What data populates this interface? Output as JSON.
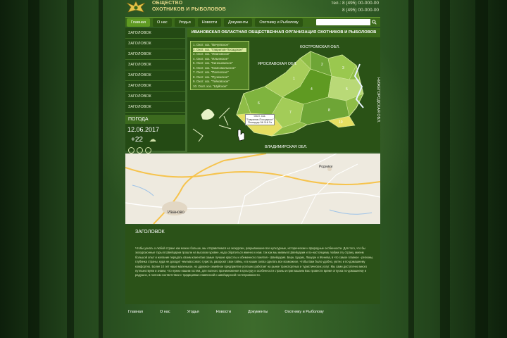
{
  "header": {
    "logo_line1": "ОБЩЕСТВО",
    "logo_line2": "ОХОТНИКОВ И РЫБОЛОВОВ",
    "phone1": "тел.: 8 (495) 00-000-00",
    "phone2": "8 (495) 00-000-00"
  },
  "nav": {
    "items": [
      "Главная",
      "О нас",
      "Угодья",
      "Новости",
      "Документы",
      "Охотнику и Рыболову"
    ],
    "search_button": "Q"
  },
  "sidebar": {
    "items": [
      "ЗАГОЛОВОК",
      "ЗАГОЛОВОК",
      "ЗАГОЛОВОК",
      "ЗАГОЛОВОК",
      "ЗАГОЛОВОК",
      "ЗАГОЛОВОК",
      "ЗАГОЛОВОК",
      "ЗАГОЛОВОК"
    ],
    "weather_title": "ПОГОДА",
    "date": "12.06.2017",
    "temp": "+22"
  },
  "map": {
    "title": "ИВАНОВСКАЯ ОБЛАСТНАЯ ОБЩЕСТВЕННАЯ ОРГАНИЗАЦИЯ ОХОТНИКОВ И РЫБОЛОВОВ",
    "list": [
      "1. Охот. хоз. \"Вичугвское\"",
      "2. Охот. хоз. \"Гаврилов-Посадское\"",
      "3. Охот. хоз. \"Ивановское\"",
      "4. Охот. хоз. \"Ильинское\"",
      "5. Охот. хоз. \"Кинешемское\"",
      "6. Охот. хоз. \"Комсомольское\"",
      "7. Охот. хоз. \"Палехское\"",
      "8. Охот. хоз. \"Пучежское\"",
      "9. Охот. хоз. \"Тейковское\"",
      "10. Охот. хоз. \"Шуйское\""
    ],
    "region_kostroma": "КОСТРОМСКАЯ ОБЛ.",
    "region_yaroslavl": "ЯРОСЛАВСКАЯ ОБЛ.",
    "region_vladimir": "ВЛАДИМИРСКАЯ ОБЛ.",
    "region_nizhny": "НИЖЕГОРОДСКАЯ ОБЛ.",
    "tooltip_line1": "Охот. хоз.",
    "tooltip_line2": "\"Гаврилов-Посадское\"",
    "tooltip_line3": "Площадь 56 118 Га",
    "district_numbers": [
      "1",
      "2",
      "3",
      "4",
      "5",
      "6",
      "7",
      "8",
      "9",
      "10"
    ]
  },
  "street": {
    "city": "Иваново",
    "town": "Родники"
  },
  "content": {
    "title": "ЗАГОЛОВОК",
    "text": "Чтобы узнать о любой стране как можно больше, мы отправляемся на экскурсии, разрываюшие все культурные, исторические и природные особенности. Для того, что бы экскурсионные туры в Швейцарии прошли на высоком уровне, надо обратиться именно к нам. так как мы живем в Швейцарии и по-настоящему любим эту страну, имеем большой опыт и желание передать своим клиентам самые лучшие красоты и обеменного понятия - Швейцария. Берн, Цюрих, Люцерн и Женева, в что самое главное - регионы, глубинка страны, куда не доходит чем массового туриста, раскроют свои тайны, и в наших силах сделать все возможное, чтобы Вам было удобно, уютно и по-домашнему комфортно. Более 10 лет наше маленькое, но дружное семейное предприятие успешно работает на рынке транспортных и туристических услуг. Мы сами достаточно много путешествуем и знаем, что нужно нашим гостям, для полного проникновения в культуру и особенности страны и приглашаем Вас провести время отпуска по-домашнему и радушно, в полном соответствии с традициями славянской и швейцарской гостеприимности."
  },
  "footer": {
    "items": [
      "Главная",
      "О нас",
      "Угодья",
      "Новости",
      "Документы",
      "Охотнику и Рыболову"
    ]
  },
  "colors": {
    "nav_bg": "#3b6a1a",
    "nav_active": "#5f9a22",
    "panel_bg": "#2a5216",
    "map_light": "#a7cd5a",
    "map_dark": "#5f9a22",
    "highlight": "#e6df62"
  }
}
